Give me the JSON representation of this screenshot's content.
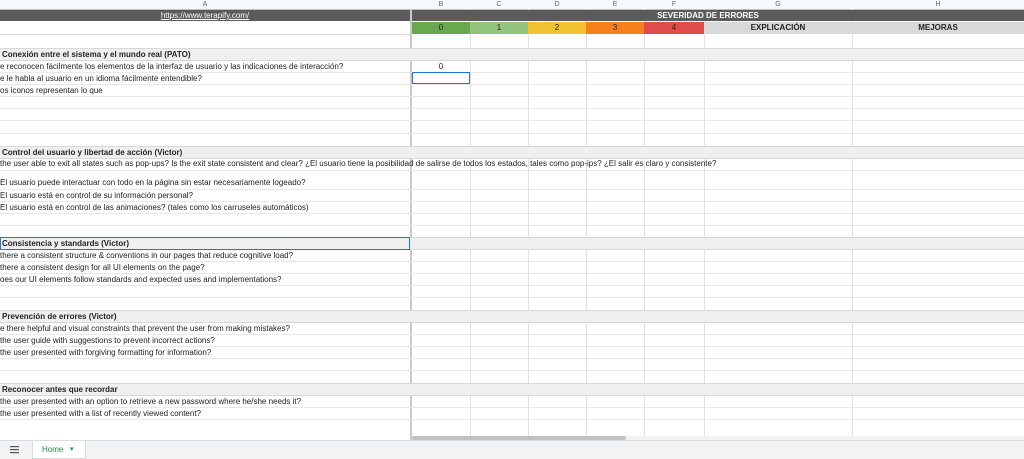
{
  "columns": [
    "A",
    "B",
    "C",
    "D",
    "E",
    "F",
    "G",
    "H"
  ],
  "header": {
    "link": "https://www.terapify.com/",
    "severity_title": "SEVERIDAD DE ERRORES",
    "severity_levels": [
      {
        "label": "0",
        "color": "#6aa84f"
      },
      {
        "label": "1",
        "color": "#93c47d"
      },
      {
        "label": "2",
        "color": "#f1c232"
      },
      {
        "label": "3",
        "color": "#f6811a"
      },
      {
        "label": "4",
        "color": "#e04b4b"
      }
    ],
    "explicacion": "EXPLICACIÓN",
    "mejoras": "MEJORAS"
  },
  "sections": [
    {
      "title": "Conexión entre el sistema y el mundo real (PATO)",
      "questions": [
        "e reconocen fácilmente los elementos de la interfaz de usuario y las indicaciones de interacción?",
        "e le habla al usuario en un idioma fácilmente entendible?",
        "os iconos representan lo que"
      ]
    },
    {
      "title": "Control del usuario y libertad de acción (Victor)",
      "questions": [
        "the user able to exit all states such as pop-ups? Is the exit state consistent and clear? ¿El usuario tiene la posibilidad de salirse de todos los estados, tales como pop-ips? ¿El salir es claro y consistente?",
        "El usuario puede interactuar con todo en la página sin estar necesariamente logeado?",
        "El usuario está en control de su información personal?",
        "El usuario está en control de las animaciones? (tales como los carruseles automáticos)"
      ]
    },
    {
      "title": "Consistencia y standards (Victor)",
      "questions": [
        "there a consistent structure & conventions in our pages that reduce cognitive load?",
        "there a consistent design for all UI elements on the page?",
        "oes our UI elements follow standards and expected uses and implementations?"
      ]
    },
    {
      "title": "Prevención de errores (Victor)",
      "questions": [
        "e there helpful and visual constraints that prevent the user from making mistakes?",
        "the user guide with suggestions to prevent incorrect actions?",
        "the user presented with forgiving formatting for information?"
      ]
    },
    {
      "title": "Reconocer antes que recordar",
      "questions": [
        "the user presented with an option to retrieve a new password where he/she needs it?",
        "the user presented with a list of recently viewed content?"
      ]
    }
  ],
  "cell_value": "0",
  "sheet_tab": "Home"
}
